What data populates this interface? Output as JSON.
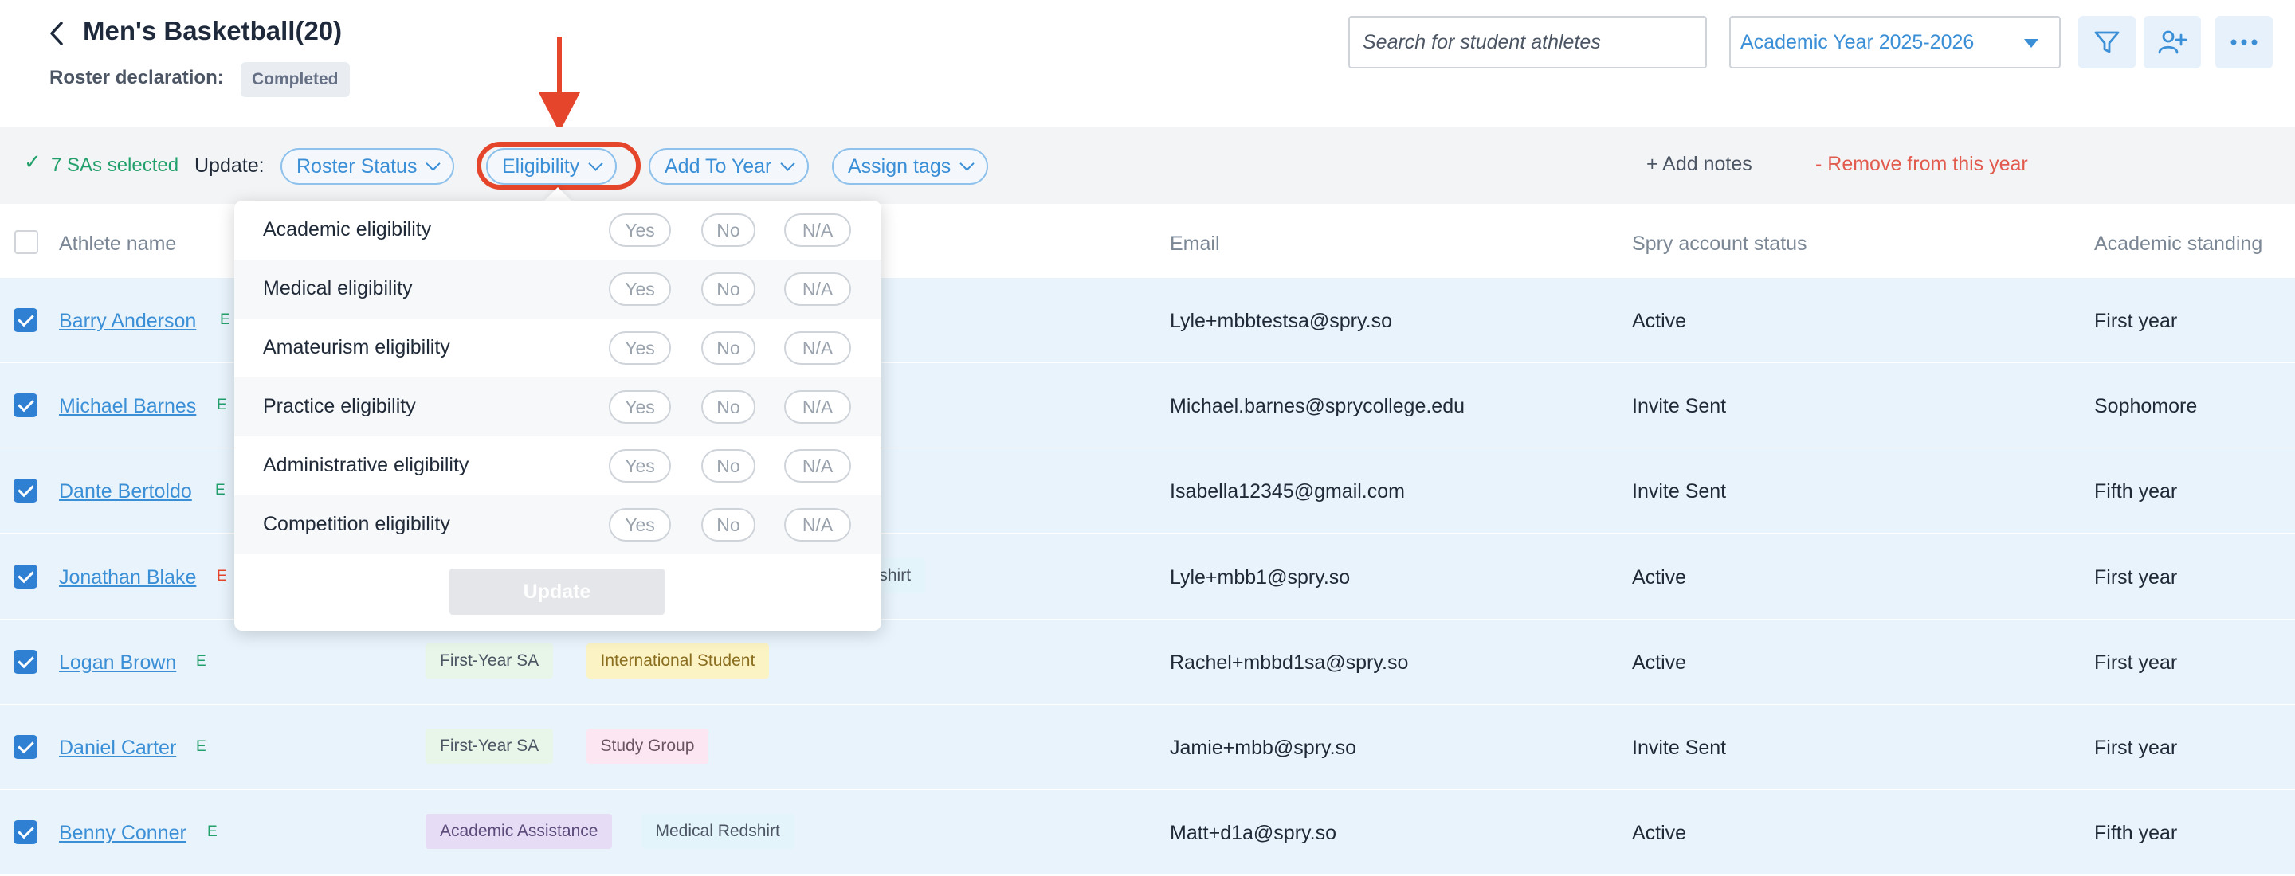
{
  "header": {
    "title": "Men's Basketball(20)",
    "roster_label": "Roster declaration:",
    "roster_status": "Completed",
    "search_placeholder": "Search for student athletes",
    "year_select": "Academic Year 2025-2026"
  },
  "bulk_bar": {
    "selected_text": "7 SAs selected",
    "update_label": "Update:",
    "pills": [
      "Roster Status",
      "Eligibility",
      "Add To Year",
      "Assign tags"
    ],
    "add_notes": "+ Add notes",
    "remove": "- Remove from this year"
  },
  "table": {
    "columns": [
      "Athlete name",
      "Email",
      "Spry account status",
      "Academic standing"
    ],
    "rows": [
      {
        "name": "Barry Anderson",
        "elig": "E",
        "elig_color": "#22a06b",
        "tags": [],
        "email": "Lyle+mbbtestsa@spry.so",
        "status": "Active",
        "standing": "First year"
      },
      {
        "name": "Michael Barnes",
        "elig": "E",
        "elig_color": "#22a06b",
        "tags": [],
        "email": "Michael.barnes@sprycollege.edu",
        "status": "Invite Sent",
        "standing": "Sophomore"
      },
      {
        "name": "Dante Bertoldo",
        "elig": "E",
        "elig_color": "#22a06b",
        "tags": [],
        "email": "Isabella12345@gmail.com",
        "status": "Invite Sent",
        "standing": "Fifth year"
      },
      {
        "name": "Jonathan Blake",
        "elig": "E",
        "elig_color": "#e5452b",
        "tags": [
          "edshirt"
        ],
        "email": "Lyle+mbb1@spry.so",
        "status": "Active",
        "standing": "First year"
      },
      {
        "name": "Logan Brown",
        "elig": "E",
        "elig_color": "#22a06b",
        "tags": [
          "First-Year SA",
          "International Student"
        ],
        "email": "Rachel+mbbd1sa@spry.so",
        "status": "Active",
        "standing": "First year"
      },
      {
        "name": "Daniel Carter",
        "elig": "E",
        "elig_color": "#22a06b",
        "tags": [
          "First-Year SA",
          "Study Group"
        ],
        "email": "Jamie+mbb@spry.so",
        "status": "Invite Sent",
        "standing": "First year"
      },
      {
        "name": "Benny Conner",
        "elig": "E",
        "elig_color": "#22a06b",
        "tags": [
          "Academic Assistance",
          "Medical Redshirt"
        ],
        "email": "Matt+d1a@spry.so",
        "status": "Active",
        "standing": "Fifth year"
      }
    ]
  },
  "eligibility_dropdown": {
    "rows": [
      "Academic eligibility",
      "Medical eligibility",
      "Amateurism eligibility",
      "Practice eligibility",
      "Administrative eligibility",
      "Competition eligibility"
    ],
    "options": [
      "Yes",
      "No",
      "N/A"
    ],
    "update_button": "Update"
  },
  "colors": {
    "accent": "#3b8fd6",
    "success": "#22a06b",
    "danger": "#e25b4f",
    "highlight": "#e5452b",
    "row_bg": "#e8f3fb"
  }
}
